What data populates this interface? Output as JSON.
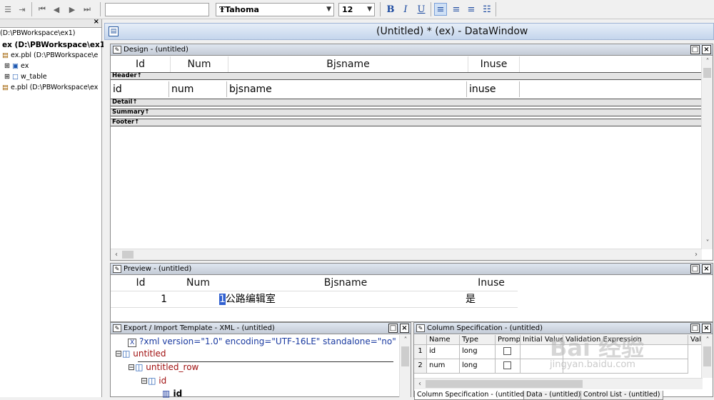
{
  "toolbar": {
    "font_name": "Tahoma",
    "font_size": "12",
    "bold": "B",
    "italic": "I",
    "underline": "U"
  },
  "tree": {
    "items": [
      {
        "label": "(D:\\PBWorkspace\\ex1)"
      },
      {
        "label": "ex (D:\\PBWorkspace\\ex1"
      },
      {
        "label": "ex.pbl (D:\\PBWorkspace\\e"
      },
      {
        "label": "ex"
      },
      {
        "label": "w_table"
      },
      {
        "label": "e.pbl (D:\\PBWorkspace\\ex"
      }
    ]
  },
  "window": {
    "title": "(Untitled) * (ex) - DataWindow"
  },
  "design": {
    "title": "Design - (untitled)",
    "headers": [
      "Id",
      "Num",
      "Bjsname",
      "Inuse"
    ],
    "detail": [
      "id",
      "num",
      "bjsname",
      "inuse"
    ],
    "bands": {
      "header": "Header↑",
      "detail": "Detail↑",
      "summary": "Summary↑",
      "footer": "Footer↑"
    }
  },
  "preview": {
    "title": "Preview - (untitled)",
    "headers": [
      "Id",
      "Num",
      "Bjsname",
      "Inuse"
    ],
    "row": {
      "id": "1",
      "num": "",
      "num_cursor": "1",
      "bjsname": "公路编辑室",
      "inuse": "是"
    }
  },
  "xml": {
    "title": "Export / Import Template - XML - (untitled)",
    "decl": "?xml version=\"1.0\" encoding=\"UTF-16LE\" standalone=\"no\" ?",
    "root": "untitled",
    "row": "untitled_row",
    "col1": "id",
    "col1_child": "id"
  },
  "colspec": {
    "title": "Column Specification - (untitled)",
    "headers": [
      "Name",
      "Type",
      "Prompt",
      "Initial Value",
      "Validation Expression",
      "Vali"
    ],
    "rows": [
      {
        "n": "1",
        "name": "id",
        "type": "long"
      },
      {
        "n": "2",
        "name": "num",
        "type": "long"
      }
    ],
    "tabs": [
      "Column Specification - (untitled)",
      "Data - (untitled)",
      "Control List - (untitled)"
    ]
  },
  "watermark": {
    "line1": "Bai 经验",
    "line2": "jingyan.baidu.com"
  }
}
